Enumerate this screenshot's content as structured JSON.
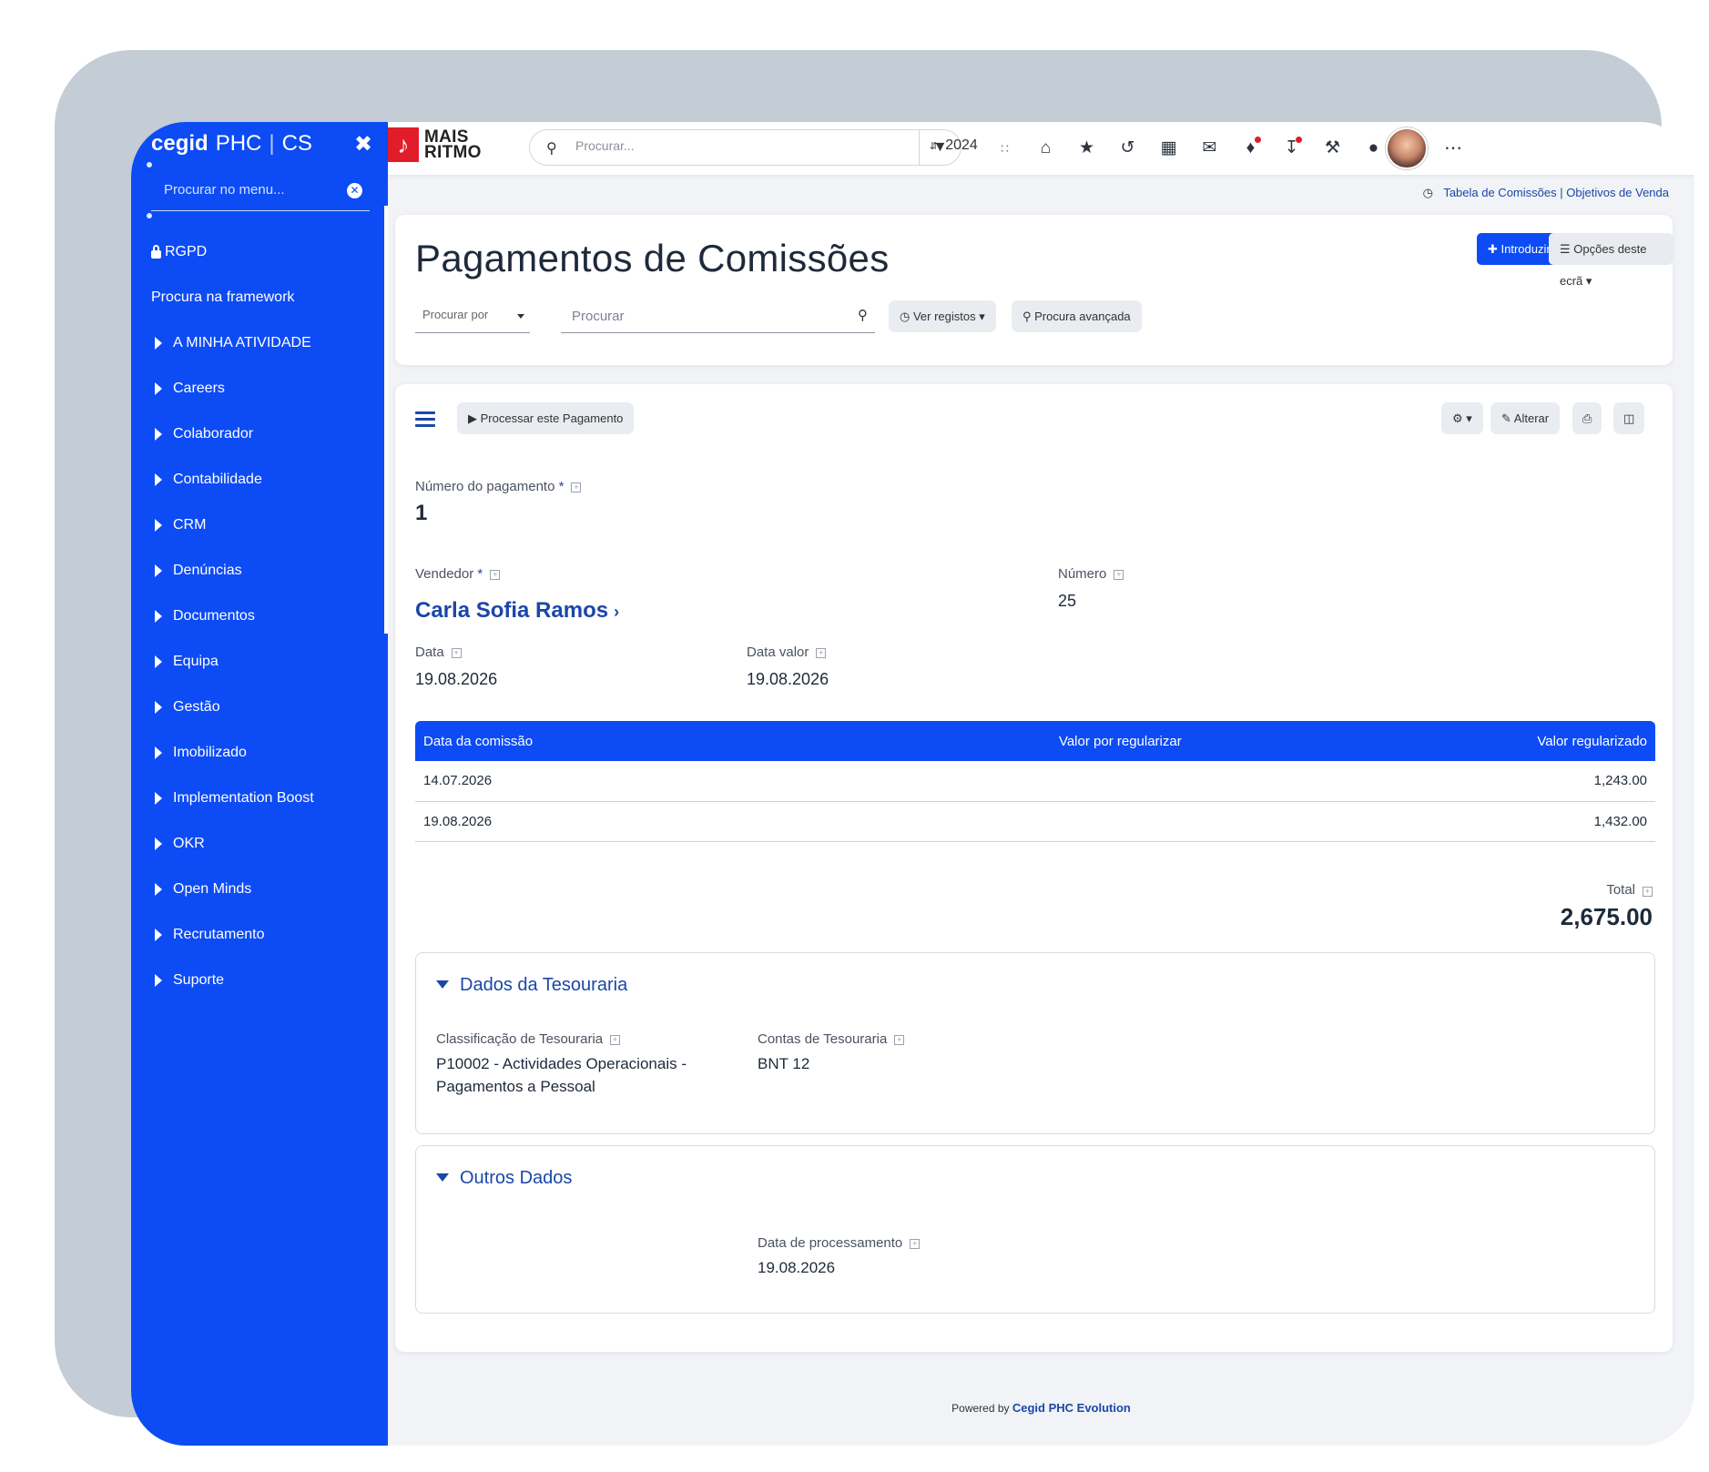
{
  "sidebar": {
    "brand_name": "cegid",
    "brand_product": "PHC",
    "brand_code": "CS",
    "close_label": "✖",
    "search_placeholder": "Procurar no menu...",
    "items": [
      {
        "label": "RGPD",
        "type": "lock"
      },
      {
        "label": "Procura na framework",
        "type": "plain"
      },
      {
        "label": "A MINHA ATIVIDADE",
        "type": "caret"
      },
      {
        "label": "Careers",
        "type": "caret"
      },
      {
        "label": "Colaborador",
        "type": "caret"
      },
      {
        "label": "Contabilidade",
        "type": "caret"
      },
      {
        "label": "CRM",
        "type": "caret"
      },
      {
        "label": "Denúncias",
        "type": "caret"
      },
      {
        "label": "Documentos",
        "type": "caret"
      },
      {
        "label": "Equipa",
        "type": "caret"
      },
      {
        "label": "Gestão",
        "type": "caret"
      },
      {
        "label": "Imobilizado",
        "type": "caret"
      },
      {
        "label": "Implementation Boost",
        "type": "caret"
      },
      {
        "label": "OKR",
        "type": "caret"
      },
      {
        "label": "Open Minds",
        "type": "caret"
      },
      {
        "label": "Recrutamento",
        "type": "caret"
      },
      {
        "label": "Suporte",
        "type": "caret"
      }
    ]
  },
  "topbar": {
    "logo_line1": "MAIS",
    "logo_line2": "RITMO",
    "search_placeholder": "Procurar...",
    "year": "2024",
    "icons": [
      "apps-grid-icon",
      "home-icon",
      "star-icon",
      "history-icon",
      "calendar-icon",
      "mail-icon",
      "bell-icon",
      "download-icon",
      "wrench-icon",
      "lightbulb-icon"
    ]
  },
  "toplinks": {
    "link1": "Tabela de Comissões",
    "separator": "|",
    "link2": "Objetivos de Venda"
  },
  "header": {
    "title": "Pagamentos de Comissões",
    "introduzir_label": "Introduzir",
    "options_label": "Opções deste ecrã",
    "search_by_label": "Procurar por",
    "search_placeholder": "Procurar",
    "view_records_label": "Ver registos",
    "advanced_search_label": "Procura avançada"
  },
  "record": {
    "process_label": "Processar este Pagamento",
    "edit_label": "Alterar",
    "payment_number_label": "Número do pagamento",
    "required_mark": "*",
    "payment_number": "1",
    "seller_label": "Vendedor",
    "seller_name": "Carla Sofia Ramos",
    "number_label": "Número",
    "number": "25",
    "date_label": "Data",
    "date": "19.08.2026",
    "value_date_label": "Data valor",
    "value_date": "19.08.2026",
    "table": {
      "headers": [
        "Data da comissão",
        "Valor por regularizar",
        "Valor regularizado"
      ],
      "rows": [
        {
          "date": "14.07.2026",
          "pending": "",
          "settled": "1,243.00"
        },
        {
          "date": "19.08.2026",
          "pending": "",
          "settled": "1,432.00"
        }
      ]
    },
    "total_label": "Total",
    "total": "2,675.00"
  },
  "treasury": {
    "title": "Dados da Tesouraria",
    "classification_label": "Classificação de Tesouraria",
    "classification_line1": "P10002 - Actividades Operacionais -",
    "classification_line2": "Pagamentos a Pessoal",
    "accounts_label": "Contas de Tesouraria",
    "accounts": "BNT 12"
  },
  "other": {
    "title": "Outros Dados",
    "processing_date_label": "Data de processamento",
    "processing_date": "19.08.2026"
  },
  "footer": {
    "powered_by": "Powered by",
    "product": "Cegid PHC Evolution"
  },
  "colors": {
    "primary": "#0d4bf5",
    "link": "#1a47a8",
    "badge": "#e11d2b"
  }
}
